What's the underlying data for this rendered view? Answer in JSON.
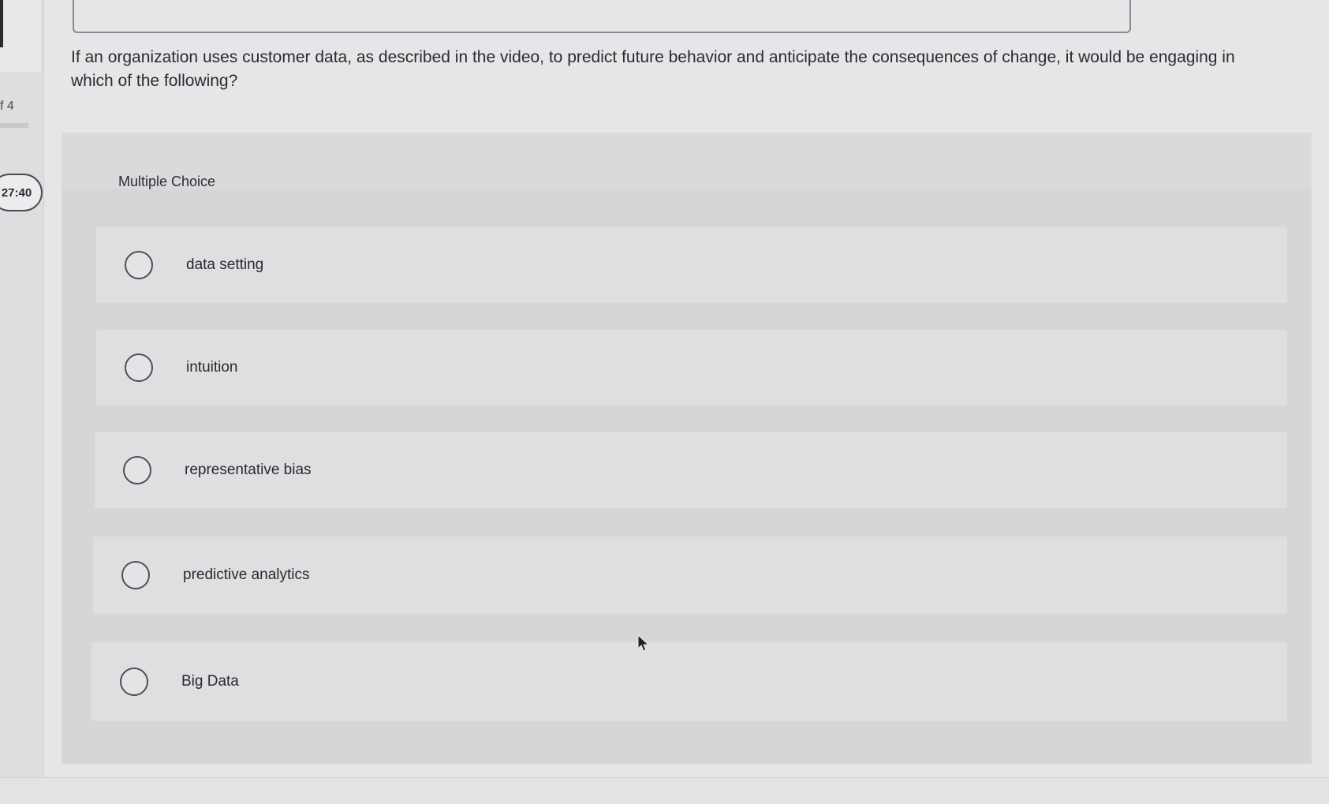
{
  "sidebar": {
    "progress_text": "f 4",
    "timer": "27:40"
  },
  "question": {
    "text": "If an organization uses customer data, as described in the video, to predict future behavior and anticipate the consequences of change, it would be engaging in which of the following?",
    "type_label": "Multiple Choice"
  },
  "options": [
    {
      "label": "data setting"
    },
    {
      "label": "intuition"
    },
    {
      "label": "representative bias"
    },
    {
      "label": "predictive analytics"
    },
    {
      "label": "Big Data"
    }
  ],
  "icons": {
    "cursor": "arrow-cursor-icon",
    "radio": "radio-button-icon"
  }
}
